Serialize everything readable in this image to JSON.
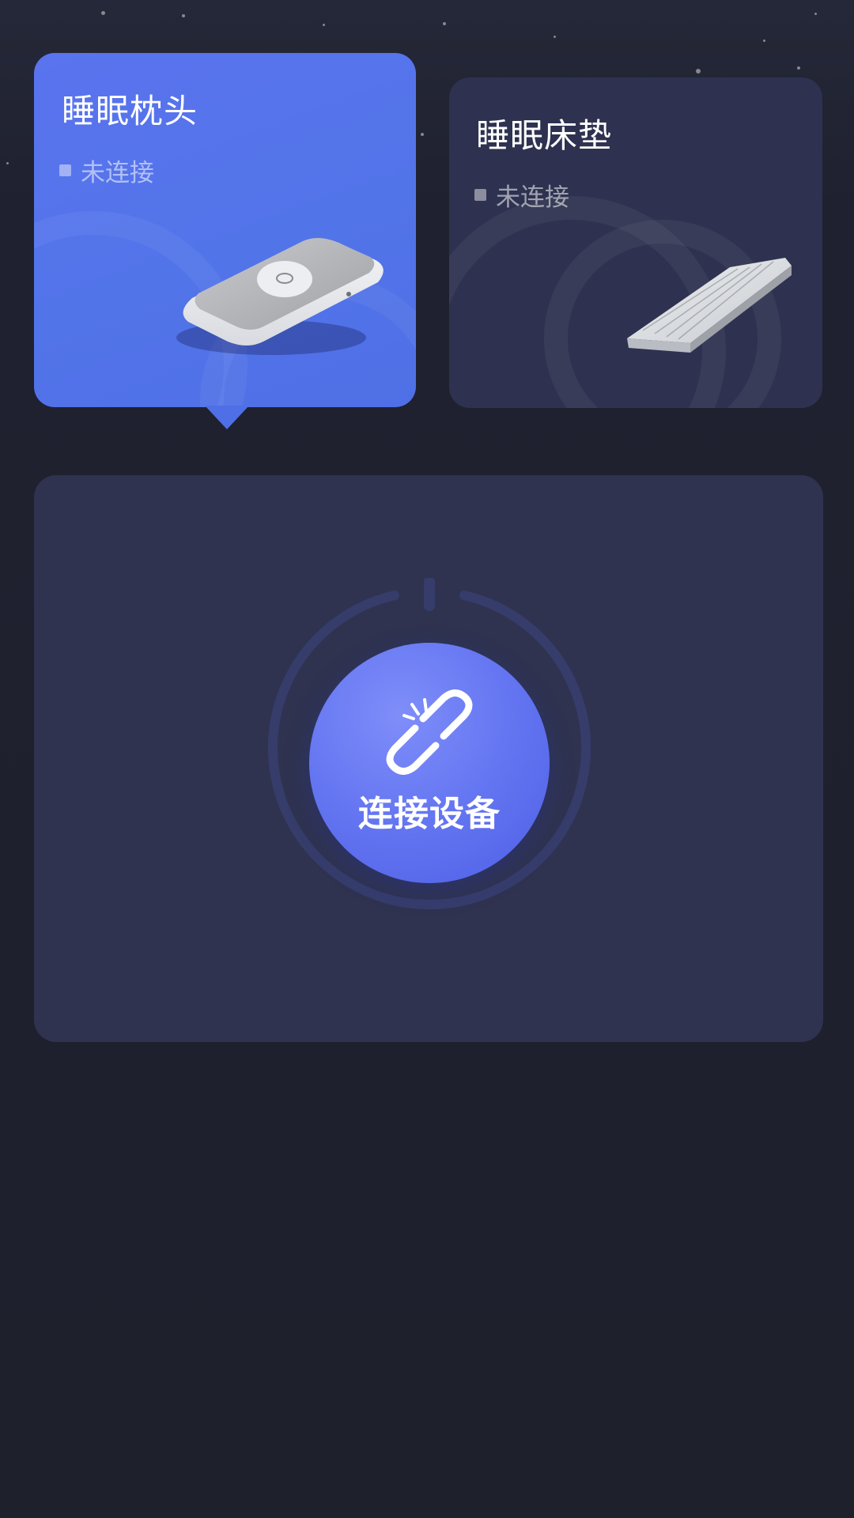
{
  "devices": [
    {
      "name": "睡眠枕头",
      "status": "未连接",
      "selected": true,
      "image_icon": "pillow-device-image"
    },
    {
      "name": "睡眠床垫",
      "status": "未连接",
      "selected": false,
      "image_icon": "mattress-image"
    }
  ],
  "connect": {
    "label": "连接设备",
    "icon": "broken-link-icon"
  },
  "colors": {
    "background": "#1e202c",
    "active_card": "#5274e9",
    "inactive_card": "#2e3250",
    "panel": "#2f3350",
    "button": "#6677f2"
  }
}
